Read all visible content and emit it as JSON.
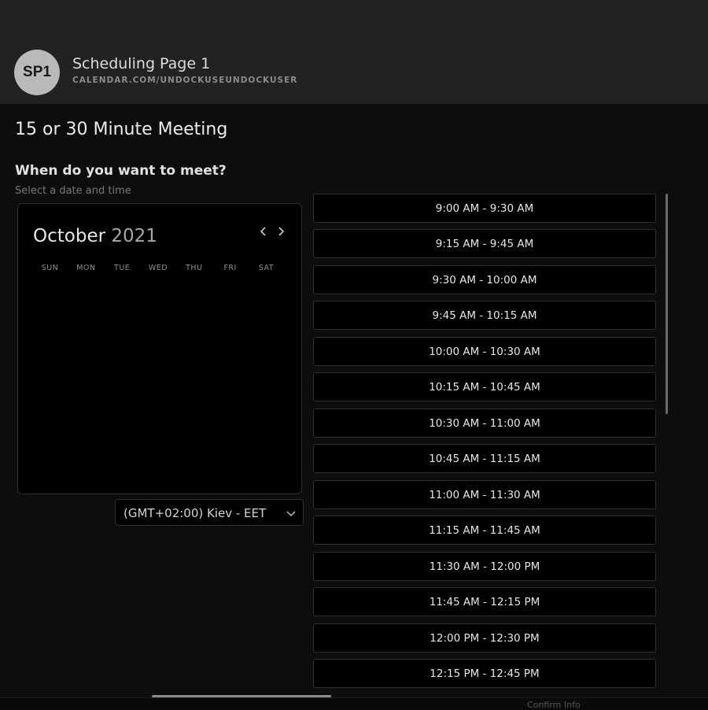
{
  "header": {
    "avatar_initials": "SP1",
    "page_name": "Scheduling Page 1",
    "page_url": "CALENDAR.COM/UNDOCKUSEUNDOCKUSER"
  },
  "meeting": {
    "title": "15 or 30 Minute Meeting",
    "question": "When do you want to meet?",
    "subtitle": "Select a date and time"
  },
  "calendar": {
    "month": "October",
    "year": "2021",
    "weekdays": [
      "SUN",
      "MON",
      "TUE",
      "WED",
      "THU",
      "FRI",
      "SAT"
    ],
    "prev_icon": "chevron-left-icon",
    "next_icon": "chevron-right-icon"
  },
  "timezone": {
    "selected": "(GMT+02:00) Kiev - EET",
    "icon": "chevron-down-icon"
  },
  "time_slots": [
    "9:00 AM - 9:30 AM",
    "9:15 AM - 9:45 AM",
    "9:30 AM - 10:00 AM",
    "9:45 AM - 10:15 AM",
    "10:00 AM - 10:30 AM",
    "10:15 AM - 10:45 AM",
    "10:30 AM - 11:00 AM",
    "10:45 AM - 11:15 AM",
    "11:00 AM - 11:30 AM",
    "11:15 AM - 11:45 AM",
    "11:30 AM - 12:00 PM",
    "11:45 AM - 12:15 PM",
    "12:00 PM - 12:30 PM",
    "12:15 PM - 12:45 PM"
  ],
  "footer": {
    "step_label": "Confirm Info"
  },
  "colors": {
    "header_bg": "#222222",
    "page_bg": "#0d0d0d",
    "avatar_bg": "#b9b9b9",
    "slot_bg": "#000000"
  }
}
